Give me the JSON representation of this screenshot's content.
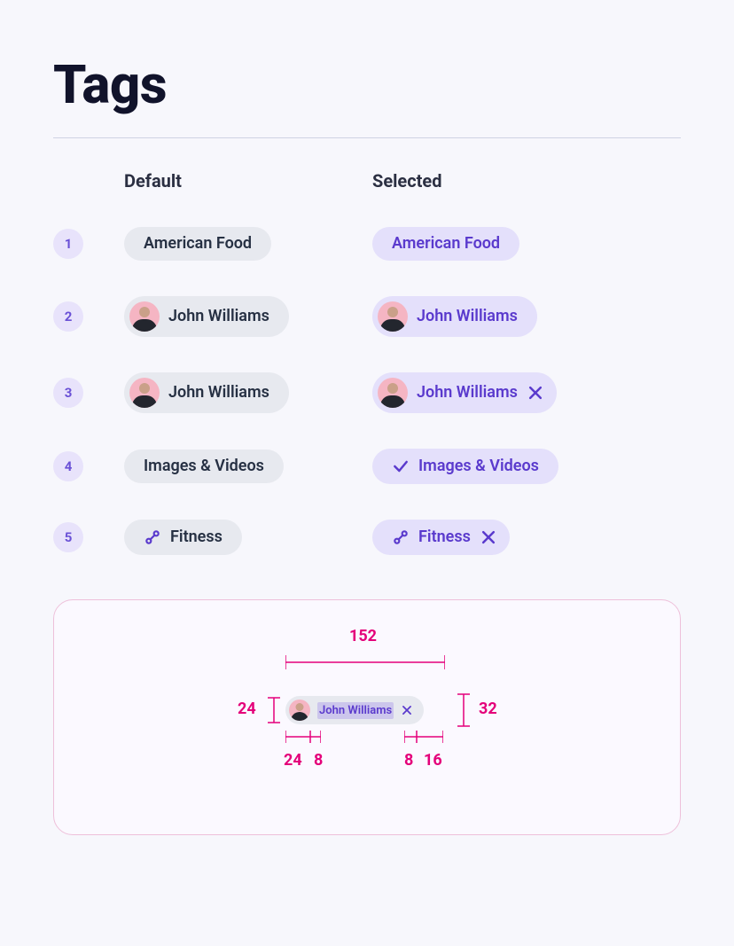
{
  "title": "Tags",
  "columns": {
    "default": "Default",
    "selected": "Selected"
  },
  "rows": [
    {
      "n": "1",
      "default_label": "American Food",
      "selected_label": "American Food"
    },
    {
      "n": "2",
      "default_label": "John Williams",
      "selected_label": "John Williams"
    },
    {
      "n": "3",
      "default_label": "John Williams",
      "selected_label": "John Williams"
    },
    {
      "n": "4",
      "default_label": "Images & Videos",
      "selected_label": "Images & Videos"
    },
    {
      "n": "5",
      "default_label": "Fitness",
      "selected_label": "Fitness"
    }
  ],
  "spec": {
    "example_label": "John Williams",
    "width": "152",
    "height": "32",
    "avatar": "24",
    "gap_left": "8",
    "gap_right": "8",
    "pad_right": "16",
    "avatar_col": "24"
  }
}
